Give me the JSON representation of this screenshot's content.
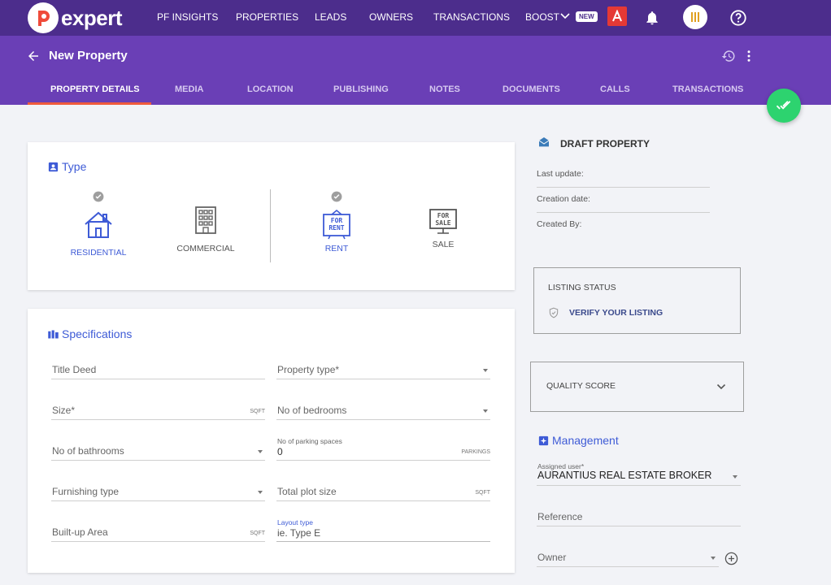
{
  "app": {
    "logo_text": "expert"
  },
  "nav": {
    "items": [
      "PF INSIGHTS",
      "PROPERTIES",
      "LEADS",
      "OWNERS",
      "TRANSACTIONS",
      "BOOST"
    ],
    "new_badge": "NEW"
  },
  "header": {
    "title": "New Property"
  },
  "tabs": [
    "PROPERTY DETAILS",
    "MEDIA",
    "LOCATION",
    "PUBLISHING",
    "NOTES",
    "DOCUMENTS",
    "CALLS",
    "TRANSACTIONS"
  ],
  "type_card": {
    "title": "Type",
    "options": [
      "RESIDENTIAL",
      "COMMERCIAL",
      "RENT",
      "SALE"
    ],
    "rent_sign_line1": "FOR",
    "rent_sign_line2": "RENT",
    "sale_sign_line1": "FOR",
    "sale_sign_line2": "SALE"
  },
  "specs": {
    "title": "Specifications",
    "title_deed": "Title Deed",
    "property_type": "Property type*",
    "size": "Size*",
    "size_unit": "SQFT",
    "bedrooms": "No of bedrooms",
    "bathrooms": "No of bathrooms",
    "parking_label": "No of parking spaces",
    "parking_value": "0",
    "parking_unit": "PARKINGS",
    "furnishing": "Furnishing type",
    "plot_size": "Total plot size",
    "plot_unit": "SQFT",
    "builtup": "Built-up Area",
    "builtup_unit": "SQFT",
    "layout_label": "Layout type",
    "layout_placeholder": "ie. Type E"
  },
  "side": {
    "draft_title": "DRAFT PROPERTY",
    "last_update": "Last update:",
    "creation_date": "Creation date:",
    "created_by": "Created By:",
    "listing_status": "LISTING STATUS",
    "verify": "VERIFY YOUR LISTING",
    "quality_score": "QUALITY SCORE",
    "management_title": "Management",
    "assigned_label": "Assigned user*",
    "assigned_value": "AURANTIUS REAL ESTATE BROKER",
    "reference": "Reference",
    "owner": "Owner"
  },
  "colors": {
    "nav_bg": "#4c2d8c",
    "header_bg": "#6a3fb6",
    "accent": "#3e5bd6",
    "tab_indicator": "#ef5a3c",
    "fab": "#2dd36f"
  }
}
